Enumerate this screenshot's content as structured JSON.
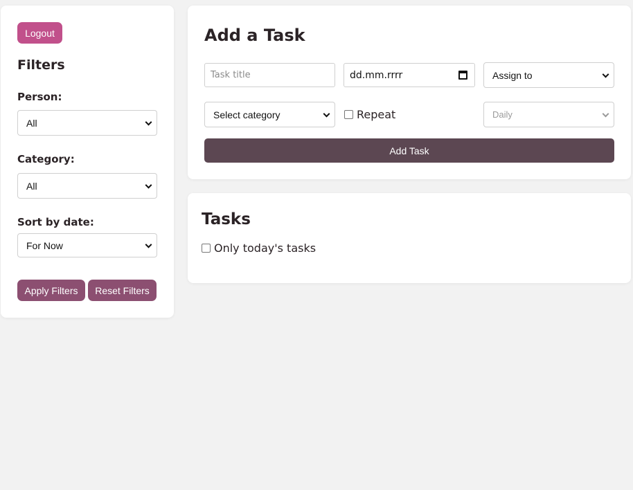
{
  "sidebar": {
    "logout_label": "Logout",
    "title": "Filters",
    "person": {
      "label": "Person:",
      "selected": "All"
    },
    "category": {
      "label": "Category:",
      "selected": "All"
    },
    "sort": {
      "label": "Sort by date:",
      "selected": "For Now"
    },
    "apply_label": "Apply Filters",
    "reset_label": "Reset Filters"
  },
  "add_task": {
    "title": "Add a Task",
    "task_title_placeholder": "Task title",
    "date_value": "dd.mm.rrrr",
    "assign_selected": "Assign to",
    "category_selected": "Select category",
    "repeat_label": "Repeat",
    "repeat_frequency_selected": "Daily",
    "submit_label": "Add Task"
  },
  "tasks": {
    "title": "Tasks",
    "only_today_label": "Only today's tasks"
  }
}
